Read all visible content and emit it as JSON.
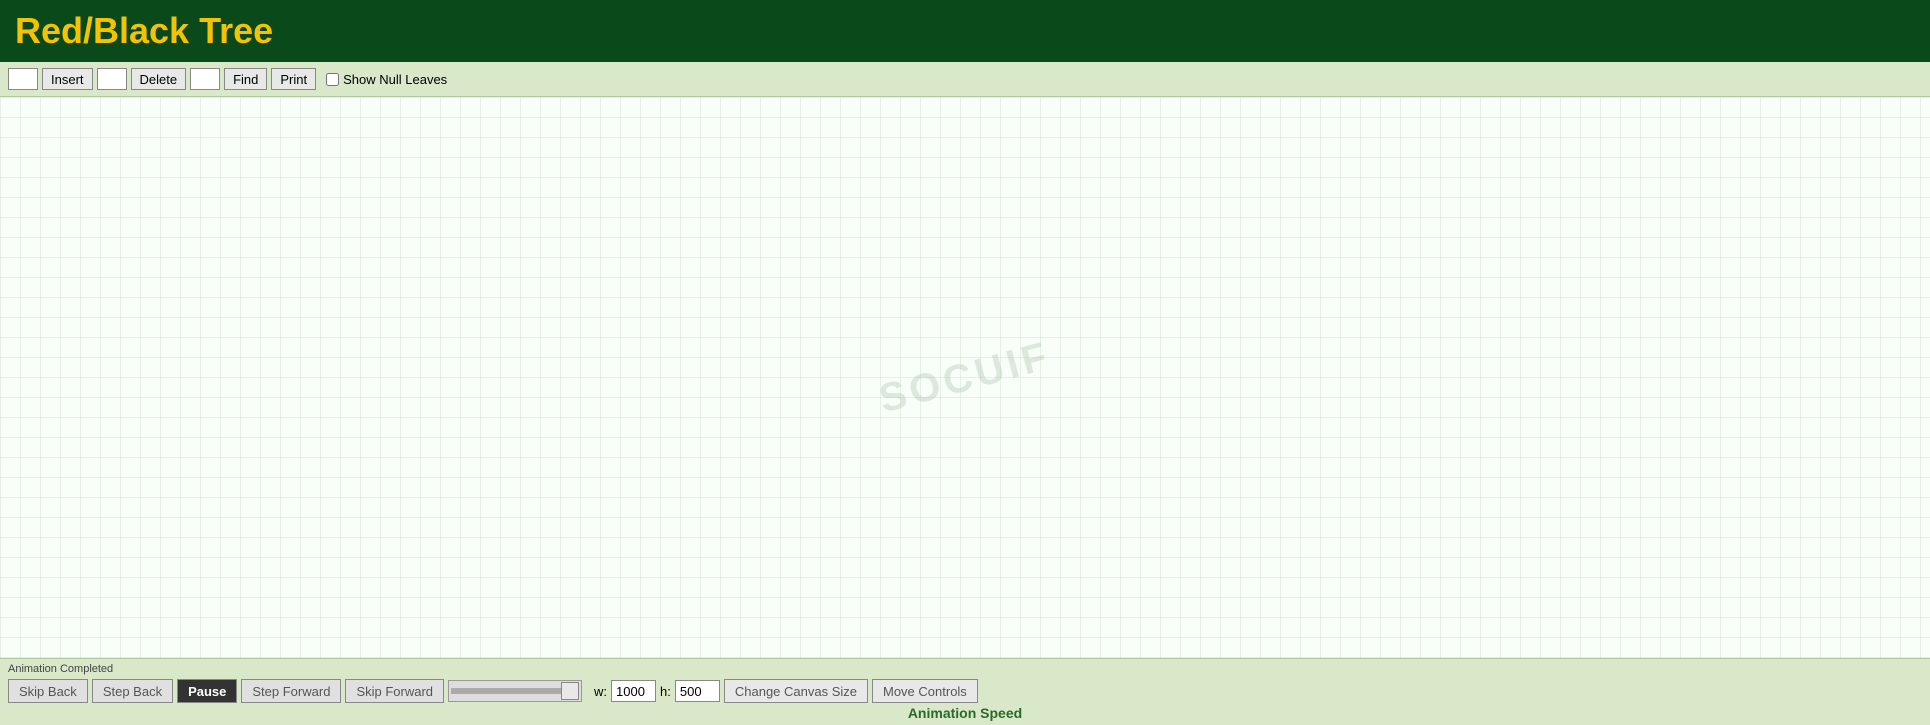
{
  "header": {
    "title": "Red/Black Tree"
  },
  "toolbar": {
    "insert_button_label": "Insert",
    "delete_button_label": "Delete",
    "find_button_label": "Find",
    "print_button_label": "Print",
    "show_null_leaves_label": "Show Null Leaves",
    "insert_input_value": "",
    "delete_input_value": "",
    "find_input_value": ""
  },
  "canvas": {
    "watermark": "SOCUIF"
  },
  "status": {
    "animation_status": "Animation Completed"
  },
  "bottom_controls": {
    "skip_back_label": "Skip Back",
    "step_back_label": "Step Back",
    "pause_label": "Pause",
    "step_forward_label": "Step Forward",
    "skip_forward_label": "Skip Forward",
    "width_label": "w:",
    "height_label": "h:",
    "width_value": "1000",
    "height_value": "500",
    "change_canvas_size_label": "Change Canvas Size",
    "move_controls_label": "Move Controls",
    "animation_speed_label": "Animation Speed"
  }
}
